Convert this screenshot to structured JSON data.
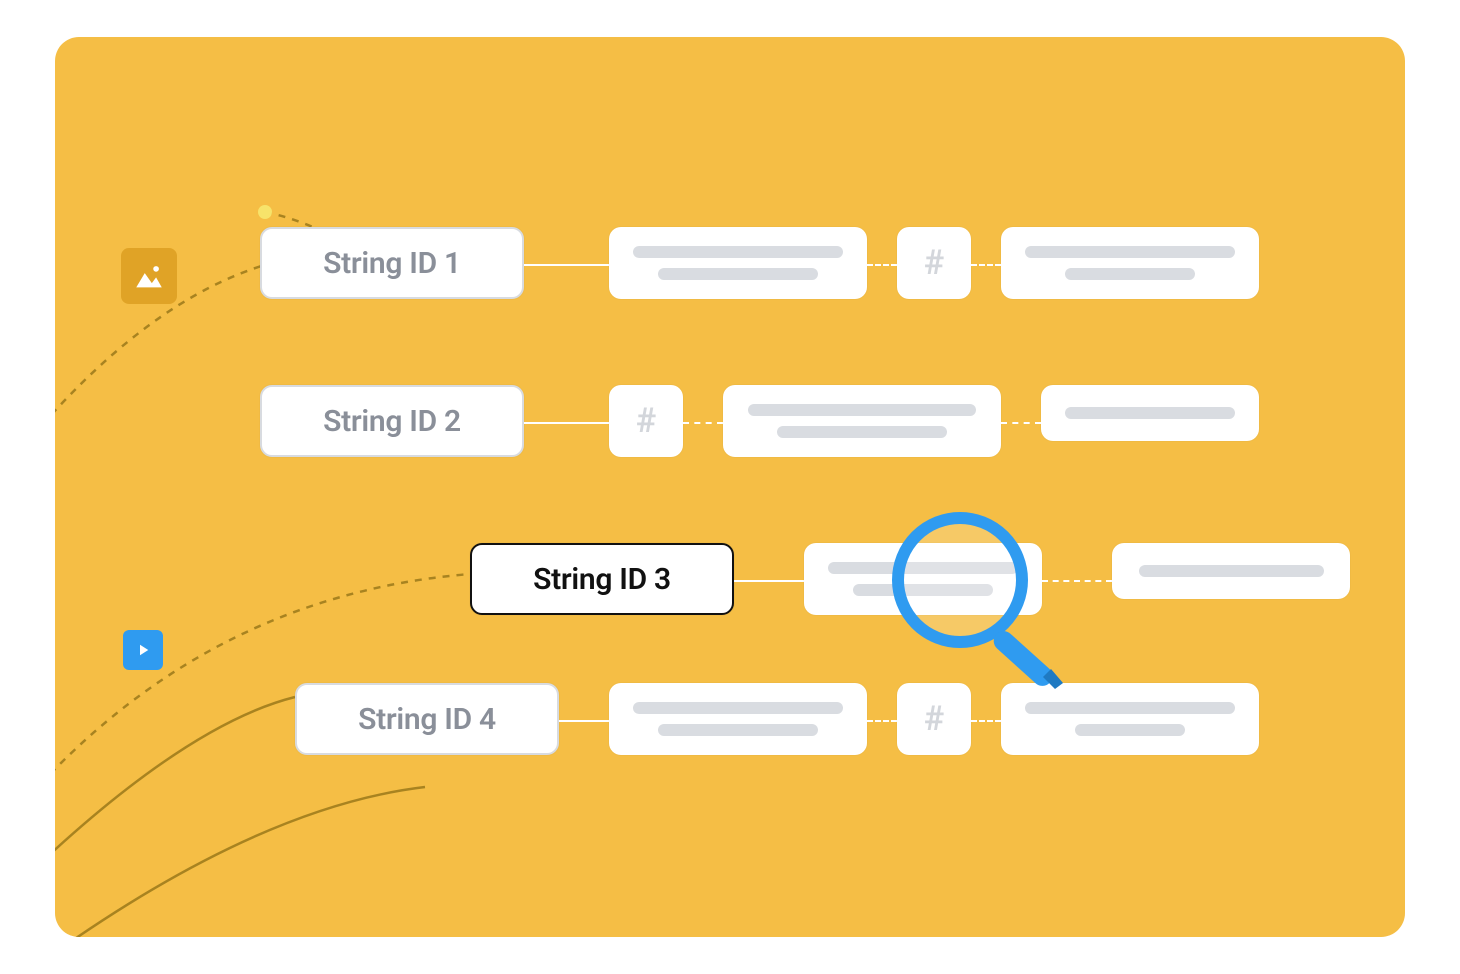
{
  "rows": [
    {
      "id": "row-1",
      "label": "String ID 1",
      "highlighted": false,
      "hash_label": "#"
    },
    {
      "id": "row-2",
      "label": "String ID 2",
      "highlighted": false,
      "hash_label": "#"
    },
    {
      "id": "row-3",
      "label": "String ID 3",
      "highlighted": true,
      "hash_label": "#"
    },
    {
      "id": "row-4",
      "label": "String ID 4",
      "highlighted": false,
      "hash_label": "#"
    }
  ],
  "icons": {
    "image_icon": "image-icon",
    "play_icon": "play-icon",
    "magnifier_icon": "magnifier-icon"
  },
  "colors": {
    "background": "#F5BE45",
    "pill_bg": "#FFFFFF",
    "muted_text": "#8A8F99",
    "active_text": "#111111",
    "placeholder_bar": "#D9DCE1",
    "magnifier": "#2F9BF0",
    "image_icon_bg": "#E0A326",
    "play_icon_bg": "#2F9BF0"
  }
}
